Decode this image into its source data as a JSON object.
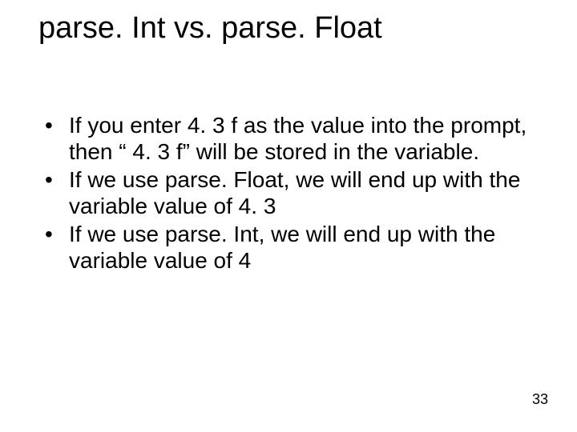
{
  "title": "parse. Int vs. parse. Float",
  "bullets": [
    "If you enter 4. 3 f as the value into the prompt, then “ 4. 3 f” will be stored in the variable.",
    "If we use parse. Float, we will end up with the variable value of 4. 3",
    "If we use parse. Int, we will end up with the variable value of 4"
  ],
  "page_number": "33"
}
